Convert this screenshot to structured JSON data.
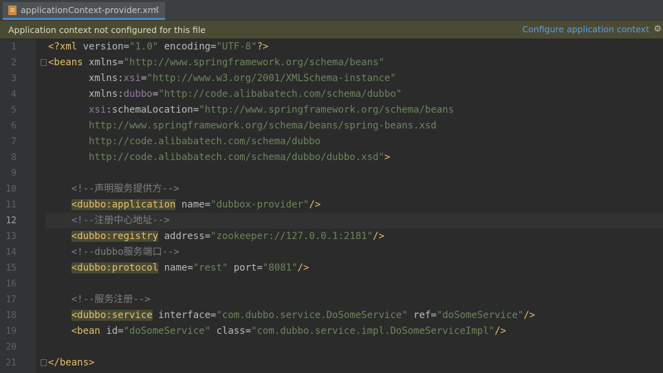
{
  "tab": {
    "filename": "applicationContext-provider.xml",
    "close": "✕",
    "icon": "xml-file-icon"
  },
  "banner": {
    "message": "Application context not configured for this file",
    "action": "Configure application context"
  },
  "colors": {
    "background": "#2b2b2b",
    "gutter": "#313335",
    "tag": "#e8bf6a",
    "string": "#6a8759",
    "comment": "#808080",
    "namespace": "#9876aa",
    "banner": "#4b4b33"
  },
  "editor": {
    "current_line": 12,
    "lines": [
      {
        "n": "1",
        "t": [
          [
            "p",
            "<?xml "
          ],
          [
            "an",
            "version"
          ],
          [
            "an",
            "="
          ],
          [
            "v",
            "\"1.0\""
          ],
          [
            "an",
            " encoding"
          ],
          [
            "an",
            "="
          ],
          [
            "v",
            "\"UTF-8\""
          ],
          [
            "p",
            "?>"
          ]
        ]
      },
      {
        "n": "2",
        "t": [
          [
            "p",
            "<beans "
          ],
          [
            "an",
            "xmlns"
          ],
          [
            "an",
            "="
          ],
          [
            "v",
            "\"http://www.springframework.org/schema/beans\""
          ]
        ]
      },
      {
        "n": "3",
        "t": [
          [
            "an",
            "       xmlns:"
          ],
          [
            "ns",
            "xsi"
          ],
          [
            "an",
            "="
          ],
          [
            "v",
            "\"http://www.w3.org/2001/XMLSchema-instance\""
          ]
        ]
      },
      {
        "n": "4",
        "t": [
          [
            "an",
            "       xmlns:"
          ],
          [
            "ns",
            "dubbo"
          ],
          [
            "an",
            "="
          ],
          [
            "v",
            "\"http://code.alibabatech.com/schema/dubbo\""
          ]
        ]
      },
      {
        "n": "5",
        "t": [
          [
            "ns",
            "       xsi"
          ],
          [
            "an",
            ":schemaLocation"
          ],
          [
            "an",
            "="
          ],
          [
            "v",
            "\"http://www.springframework.org/schema/beans"
          ]
        ]
      },
      {
        "n": "6",
        "t": [
          [
            "v",
            "       http://www.springframework.org/schema/beans/spring-beans.xsd"
          ]
        ]
      },
      {
        "n": "7",
        "t": [
          [
            "v",
            "       http://code.alibabatech.com/schema/dubbo"
          ]
        ]
      },
      {
        "n": "8",
        "t": [
          [
            "v",
            "       http://code.alibabatech.com/schema/dubbo/dubbo.xsd\""
          ],
          [
            "p",
            ">"
          ]
        ]
      },
      {
        "n": "9",
        "t": []
      },
      {
        "n": "10",
        "t": [
          [
            "cm",
            "    <!--声明服务提供方-->"
          ]
        ]
      },
      {
        "n": "11",
        "t": [
          [
            "an",
            "    "
          ],
          [
            "p hl",
            "<dubbo:application"
          ],
          [
            "an",
            " name"
          ],
          [
            "an",
            "="
          ],
          [
            "v",
            "\"dubbox-provider\""
          ],
          [
            "p",
            "/>"
          ]
        ]
      },
      {
        "n": "12",
        "t": [
          [
            "cm",
            "    <!--注册中心地址-->"
          ]
        ]
      },
      {
        "n": "13",
        "t": [
          [
            "an",
            "    "
          ],
          [
            "p hl",
            "<dubbo:registry"
          ],
          [
            "an",
            " address"
          ],
          [
            "an",
            "="
          ],
          [
            "v",
            "\"zookeeper://127.0.0.1:2181\""
          ],
          [
            "p",
            "/>"
          ]
        ]
      },
      {
        "n": "14",
        "t": [
          [
            "cm",
            "    <!--dubbo服务端口-->"
          ]
        ]
      },
      {
        "n": "15",
        "t": [
          [
            "an",
            "    "
          ],
          [
            "p hl",
            "<dubbo:protocol"
          ],
          [
            "an",
            " name"
          ],
          [
            "an",
            "="
          ],
          [
            "v",
            "\"rest\""
          ],
          [
            "an",
            " port"
          ],
          [
            "an",
            "="
          ],
          [
            "v",
            "\"8081\""
          ],
          [
            "p",
            "/>"
          ]
        ]
      },
      {
        "n": "16",
        "t": []
      },
      {
        "n": "17",
        "t": [
          [
            "cm",
            "    <!--服务注册-->"
          ]
        ]
      },
      {
        "n": "18",
        "t": [
          [
            "an",
            "    "
          ],
          [
            "p hl",
            "<dubbo:service"
          ],
          [
            "an",
            " interface"
          ],
          [
            "an",
            "="
          ],
          [
            "v",
            "\"com.dubbo.service.DoSomeService\""
          ],
          [
            "an",
            " ref"
          ],
          [
            "an",
            "="
          ],
          [
            "v",
            "\"doSomeService\""
          ],
          [
            "p",
            "/>"
          ]
        ]
      },
      {
        "n": "19",
        "t": [
          [
            "an",
            "    "
          ],
          [
            "p",
            "<bean "
          ],
          [
            "an",
            "id"
          ],
          [
            "an",
            "="
          ],
          [
            "v",
            "\"doSomeService\""
          ],
          [
            "an",
            " class"
          ],
          [
            "an",
            "="
          ],
          [
            "v",
            "\"com.dubbo.service.impl.DoSomeServiceImpl\""
          ],
          [
            "p",
            "/>"
          ]
        ]
      },
      {
        "n": "20",
        "t": []
      },
      {
        "n": "21",
        "t": [
          [
            "p",
            "</beans>"
          ]
        ]
      }
    ]
  }
}
